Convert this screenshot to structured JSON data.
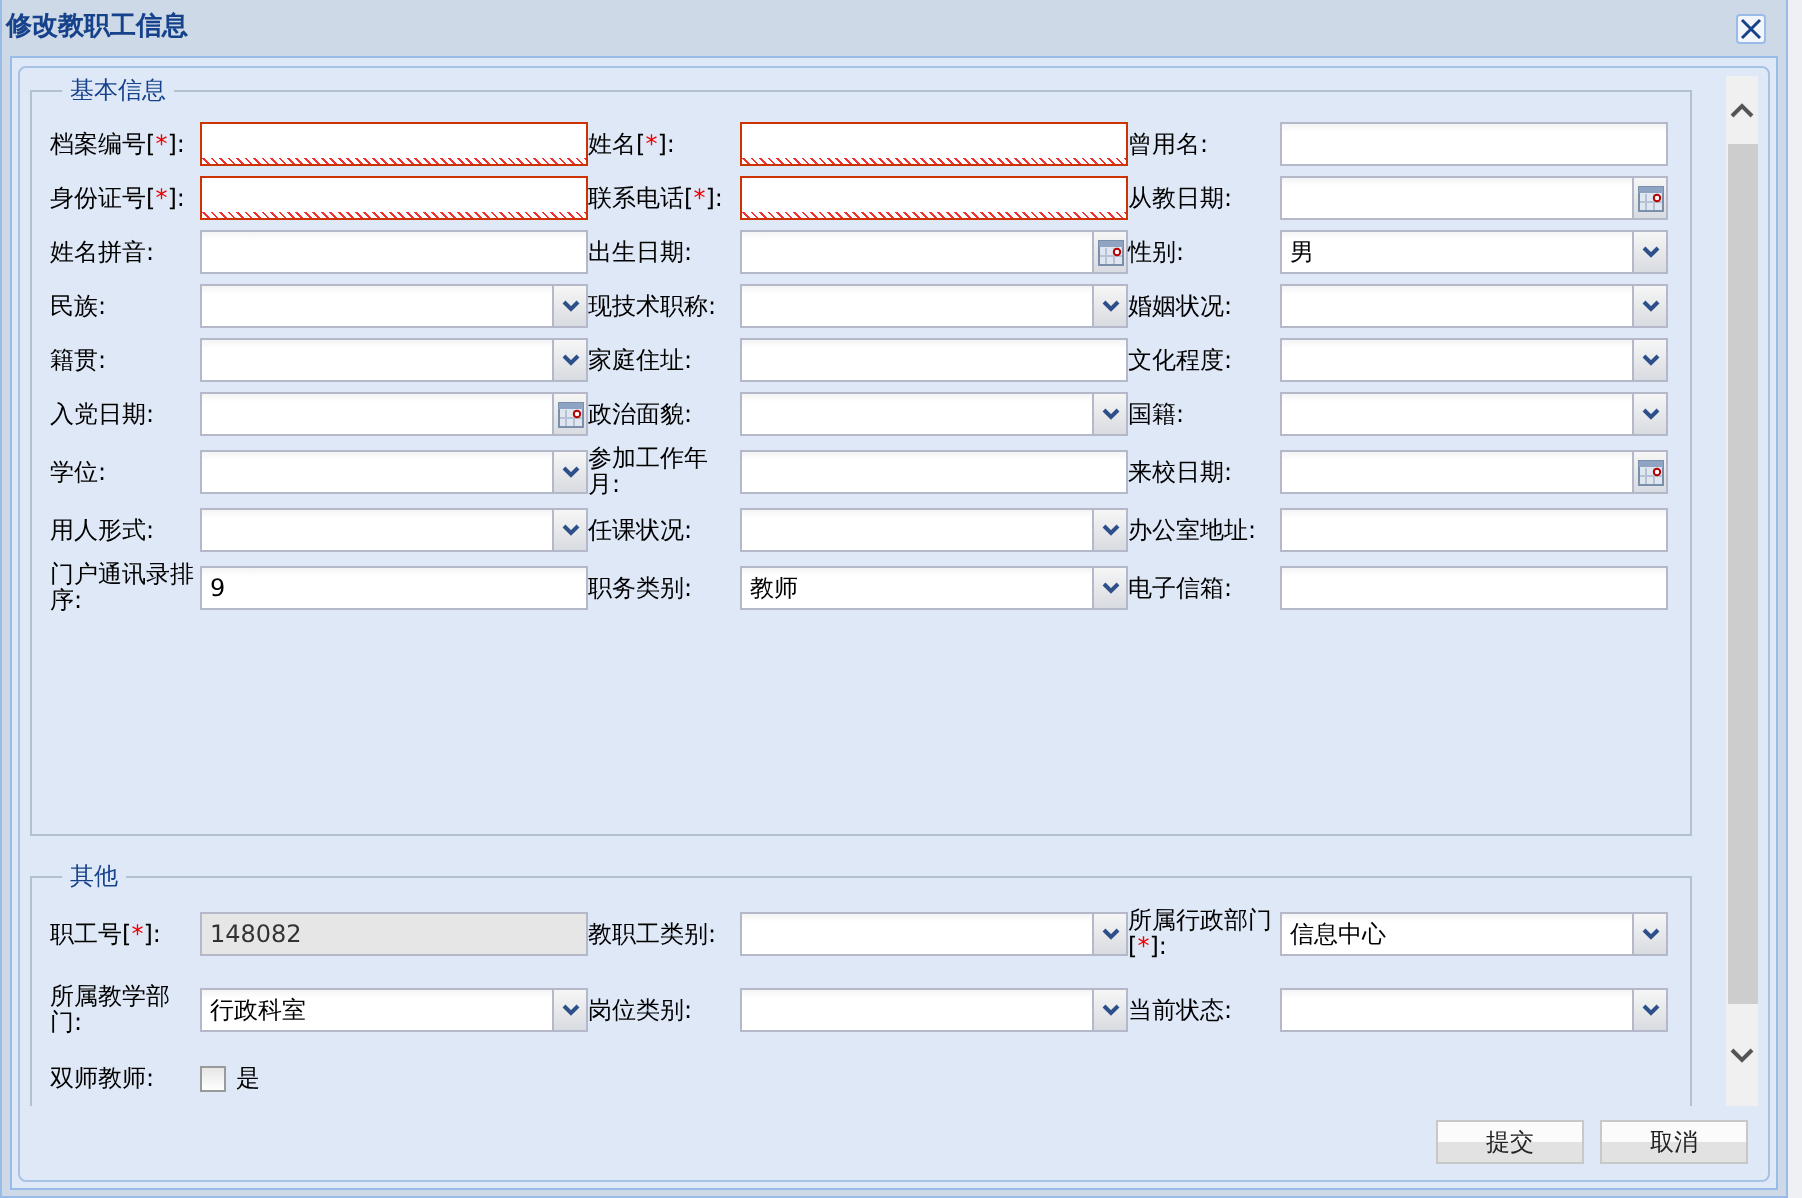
{
  "window": {
    "title": "修改教职工信息"
  },
  "sections": [
    {
      "legend": "基本信息",
      "rows": [
        [
          {
            "label": "档案编号[",
            "required_mark": "*",
            "label_suffix": "]:",
            "kind": "text",
            "invalid": true
          },
          {
            "label": "姓名[",
            "required_mark": "*",
            "label_suffix": "]:",
            "kind": "text",
            "invalid": true
          },
          {
            "label": "曾用名:",
            "kind": "text",
            "invalid": false
          }
        ],
        [
          {
            "label": "身份证号[",
            "required_mark": "*",
            "label_suffix": "]:",
            "kind": "text",
            "invalid": true
          },
          {
            "label": "联系电话[",
            "required_mark": "*",
            "label_suffix": "]:",
            "kind": "text",
            "invalid": true
          },
          {
            "label": "从教日期:",
            "kind": "date",
            "invalid": false
          }
        ],
        [
          {
            "label": "姓名拼音:",
            "kind": "text",
            "invalid": false
          },
          {
            "label": "出生日期:",
            "kind": "date",
            "invalid": false
          },
          {
            "label": "性别:",
            "kind": "select",
            "value": "男",
            "invalid": false
          }
        ],
        [
          {
            "label": "民族:",
            "kind": "select",
            "invalid": false
          },
          {
            "label": "现技术职称:",
            "kind": "select",
            "invalid": false
          },
          {
            "label": "婚姻状况:",
            "kind": "select",
            "invalid": false
          }
        ],
        [
          {
            "label": "籍贯:",
            "kind": "select",
            "invalid": false
          },
          {
            "label": "家庭住址:",
            "kind": "text",
            "invalid": false
          },
          {
            "label": "文化程度:",
            "kind": "select",
            "invalid": false
          }
        ],
        [
          {
            "label": "入党日期:",
            "kind": "date",
            "invalid": false
          },
          {
            "label": "政治面貌:",
            "kind": "select",
            "invalid": false
          },
          {
            "label": "国籍:",
            "kind": "select",
            "invalid": false
          }
        ],
        [
          {
            "label": "学位:",
            "kind": "select",
            "invalid": false
          },
          {
            "label": "参加工作年月:",
            "kind": "text",
            "invalid": false
          },
          {
            "label": "来校日期:",
            "kind": "date",
            "invalid": false
          }
        ],
        [
          {
            "label": "用人形式:",
            "kind": "select",
            "invalid": false
          },
          {
            "label": "任课状况:",
            "kind": "select",
            "invalid": false
          },
          {
            "label": "办公室地址:",
            "kind": "text",
            "invalid": false
          }
        ],
        [
          {
            "label": "门户通讯录排序:",
            "kind": "text",
            "value": "9",
            "invalid": false
          },
          {
            "label": "职务类别:",
            "kind": "select",
            "value": "教师",
            "invalid": false
          },
          {
            "label": "电子信箱:",
            "kind": "text",
            "invalid": false
          }
        ]
      ]
    },
    {
      "legend": "其他",
      "rows": [
        [
          {
            "label": "职工号[",
            "required_mark": "*",
            "label_suffix": "]:",
            "kind": "readonly",
            "value": "148082",
            "invalid": false
          },
          {
            "label": "教职工类别:",
            "kind": "select",
            "invalid": false
          },
          {
            "label": "所属行政部门[",
            "required_mark": "*",
            "label_suffix": "]:",
            "kind": "select",
            "value": "信息中心",
            "invalid": false
          }
        ],
        [
          {
            "label": "所属教学部门:",
            "kind": "select",
            "value": "行政科室",
            "invalid": false
          },
          {
            "label": "岗位类别:",
            "kind": "select",
            "invalid": false
          },
          {
            "label": "当前状态:",
            "kind": "select",
            "invalid": false
          }
        ],
        [
          {
            "label": "双师教师:",
            "kind": "checkbox",
            "option": "是",
            "checked": false
          }
        ]
      ]
    }
  ],
  "buttons": [
    "提交",
    "取消"
  ]
}
